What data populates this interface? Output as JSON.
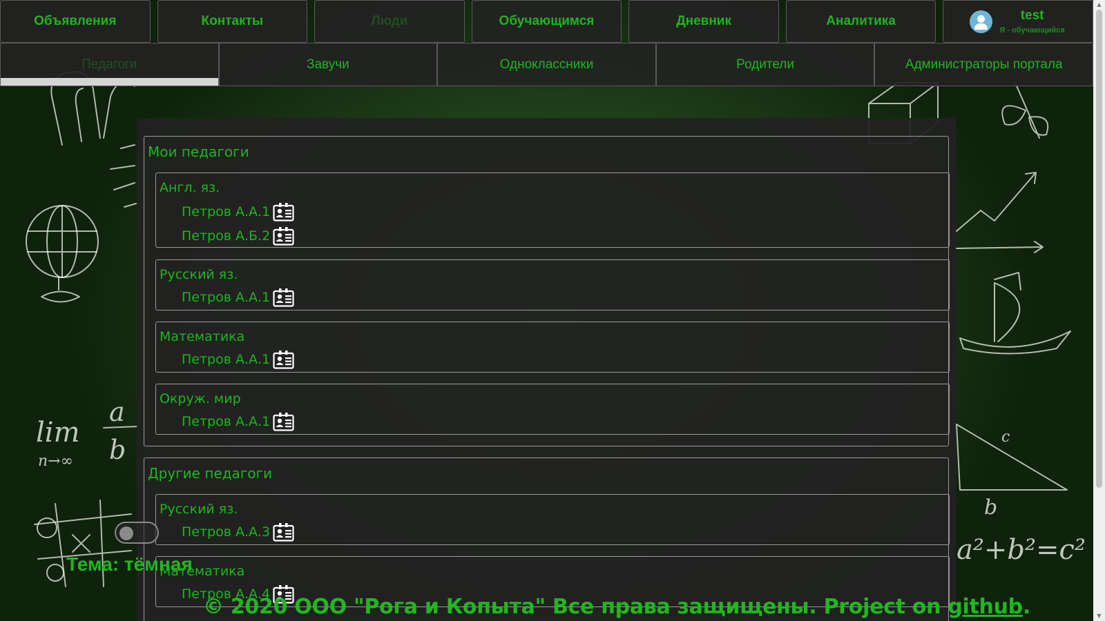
{
  "nav": {
    "top": [
      {
        "label": "Объявления"
      },
      {
        "label": "Контакты"
      },
      {
        "label": "Люди"
      },
      {
        "label": "Обучающимся"
      },
      {
        "label": "Дневник"
      },
      {
        "label": "Аналитика"
      }
    ],
    "user": {
      "name": "test",
      "role": "Я - обучающийся",
      "icon": "user-avatar-icon"
    },
    "sub": [
      {
        "label": "Педагоги"
      },
      {
        "label": "Завучи"
      },
      {
        "label": "Одноклассники"
      },
      {
        "label": "Родители"
      },
      {
        "label": "Администраторы портала"
      }
    ]
  },
  "my_teachers": {
    "title": "Мои педагоги",
    "subjects": [
      {
        "title": "Англ. яз.",
        "teachers": [
          {
            "name": "Петров А.А.1"
          },
          {
            "name": "Петров А.Б.2"
          }
        ]
      },
      {
        "title": "Русский яз.",
        "teachers": [
          {
            "name": "Петров А.А.1"
          }
        ]
      },
      {
        "title": "Математика",
        "teachers": [
          {
            "name": "Петров А.А.1"
          }
        ]
      },
      {
        "title": "Окруж. мир",
        "teachers": [
          {
            "name": "Петров А.А.1"
          }
        ]
      }
    ]
  },
  "other_teachers": {
    "title": "Другие педагоги",
    "subjects": [
      {
        "title": "Русский яз.",
        "teachers": [
          {
            "name": "Петров А.А.3"
          }
        ]
      },
      {
        "title": "Математика",
        "teachers": [
          {
            "name": "Петров А.А.4"
          }
        ]
      }
    ]
  },
  "theme": {
    "label": "Тема: тёмная"
  },
  "footer": {
    "text": "© 2020 ООО \"Рога и Копыта\" Все права защищены. Project on ",
    "link": "github",
    "suffix": "."
  },
  "colors": {
    "accent": "#1fb51f",
    "panel": "#222222",
    "board": "#24471f"
  }
}
